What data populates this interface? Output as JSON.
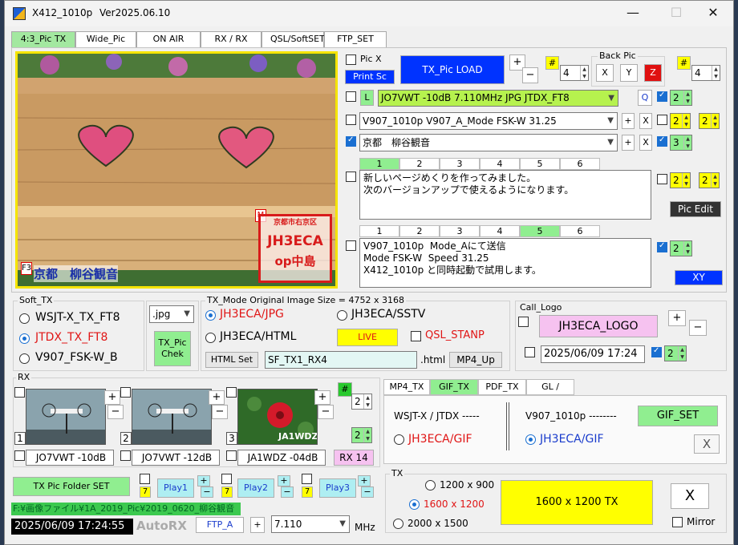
{
  "window": {
    "title": "X412_1010p",
    "version": "Ver2025.06.10",
    "min": "—",
    "max": "☐",
    "close": "✕"
  },
  "tabs": [
    "4:3_Pic TX",
    "Wide_Pic TX",
    "ON AIR",
    "RX / RX List",
    "QSL/SoftSET",
    "FTP_SET"
  ],
  "picture": {
    "overlay_text": "京都　柳谷観音",
    "f_label": "F3",
    "m_label": "M",
    "stamp_top": "京都市右京区",
    "stamp_call": "JH3ECA",
    "stamp_op": "op中島"
  },
  "top_controls": {
    "pic_x": "Pic X",
    "print_sc": "Print Sc",
    "load": "TX_Pic  LOAD",
    "plus": "+",
    "minus": "−",
    "hash": "#",
    "spin_a": "4",
    "back_pic": "Back Pic",
    "x": "X",
    "y": "Y",
    "z": "Z",
    "spin_b": "4"
  },
  "lines": {
    "l_btn": "L",
    "line1": "JO7VWT  -10dB  7.110MHz  JPG  JTDX_FT8",
    "q": "Q",
    "spin1": "2",
    "line2": "V907_1010p  V907_A_Mode  FSK-W  31.25",
    "spin2a": "2",
    "spin2b": "2",
    "line3": "京都　柳谷観音",
    "spin3": "3",
    "plus": "+",
    "x": "X"
  },
  "msg1": {
    "tabs": [
      "1",
      "2",
      "3",
      "4",
      "5",
      "6"
    ],
    "active": 0,
    "text": "新しいページめくりを作ってみました。\n次のバージョンアップで使えるようになります。",
    "spin_a": "2",
    "spin_b": "2",
    "pic_edit": "Pic  Edit"
  },
  "msg2": {
    "tabs": [
      "1",
      "2",
      "3",
      "4",
      "5",
      "6"
    ],
    "active": 4,
    "text": "V907_1010p  Mode_Aにて送信\nMode FSK-W  Speed 31.25\nX412_1010p と同時起動で試用します。",
    "spin": "2",
    "xy": "XY"
  },
  "soft_tx": {
    "label": "Soft_TX",
    "options": [
      "WSJT-X_TX_FT8",
      "JTDX_TX_FT8",
      "V907_FSK-W_B"
    ],
    "selected": 1
  },
  "format": {
    "value": ".jpg",
    "chek": "TX_Pic\nChek"
  },
  "tx_mode": {
    "label": "TX_Mode  Original  Image  Size = 4752 x 3168",
    "opt1": "JH3ECA/JPG",
    "opt2": "JH3ECA/SSTV",
    "opt3": "JH3ECA/HTML",
    "live": "LIVE",
    "qsl": "QSL_STANP",
    "html_set": "HTML Set",
    "file": "SF_TX1_RX4",
    "ext": ".html",
    "mp4": "MP4_Up"
  },
  "call_logo": {
    "label": "Call_Logo",
    "logo": "JH3ECA_LOGO",
    "datetime": "2025/06/09  17:24",
    "spin": "2"
  },
  "rx": {
    "label": "RX",
    "hash": "#",
    "spin_a": "2",
    "spin_b": "2",
    "rx14": "RX 14",
    "items": [
      {
        "num": "1",
        "call": "JO7VWT  -10dB"
      },
      {
        "num": "2",
        "call": "JO7VWT  -12dB"
      },
      {
        "num": "3",
        "call": "JA1WDZ  -04dB",
        "caption": "JA1WDZ"
      }
    ]
  },
  "right_tabs": [
    "MP4_TX",
    "GIF_TX",
    "PDF_TX",
    "GL /"
  ],
  "gif": {
    "wsjt": "WSJT-X / JTDX -----",
    "v907": "V907_1010p  --------",
    "gif_set": "GIF_SET",
    "opt_left": "JH3ECA/GIF",
    "opt_right": "JH3ECA/GIF",
    "x": "X"
  },
  "tx": {
    "label": "TX",
    "sizes": [
      "1200 x 900",
      "1600 x 1200",
      "2000 x 1500"
    ],
    "selected": 1,
    "big": "1600 x 1200   TX",
    "x": "X",
    "mirror": "Mirror"
  },
  "bottom": {
    "folder_set": "TX Pic  Folder SET",
    "seven": "7",
    "play1": "Play1",
    "play2": "Play2",
    "play3": "Play3",
    "path": "F:¥画像ファイル¥1A_2019_Pic¥2019_0620_柳谷観音",
    "clock": "2025/06/09   17:24:55",
    "autorx": "AutoRX",
    "ftp": "FTP_A",
    "plus": "+",
    "freq": "7.110",
    "mhz": "MHz"
  }
}
